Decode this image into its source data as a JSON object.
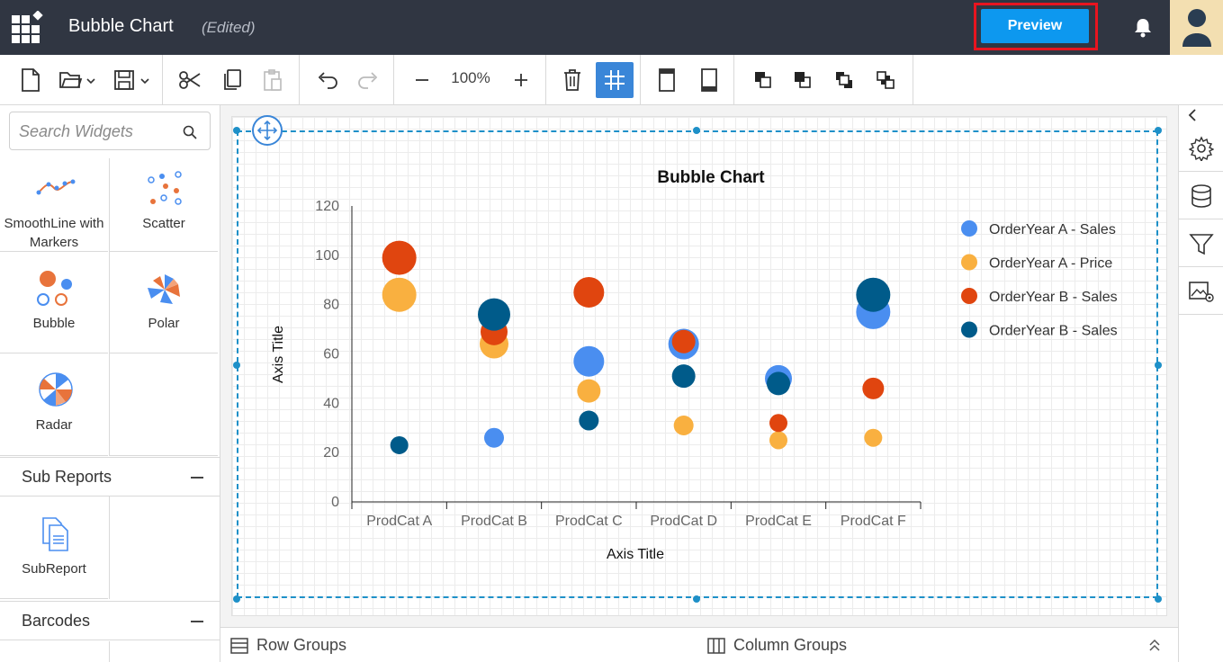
{
  "header": {
    "title": "Bubble Chart",
    "status": "(Edited)",
    "preview_label": "Preview"
  },
  "toolbar": {
    "zoom": "100%"
  },
  "search": {
    "placeholder": "Search Widgets"
  },
  "widgets": [
    {
      "label": "SmoothLine with Markers",
      "icon": "smoothline-icon"
    },
    {
      "label": "Scatter",
      "icon": "scatter-icon"
    },
    {
      "label": "Bubble",
      "icon": "bubble-icon"
    },
    {
      "label": "Polar",
      "icon": "polar-icon"
    },
    {
      "label": "Radar",
      "icon": "radar-icon"
    }
  ],
  "sections": {
    "subreports": "Sub Reports",
    "subreport_widget": "SubReport",
    "barcodes": "Barcodes"
  },
  "bottom_bar": {
    "row_groups": "Row Groups",
    "column_groups": "Column Groups"
  },
  "colors": {
    "header_bg": "#303642",
    "accent": "#0d98ef",
    "highlight": "#e8141f",
    "series": [
      "#4a8ef0",
      "#f9b040",
      "#e0450f",
      "#005b8a"
    ]
  },
  "chart_data": {
    "type": "bubble",
    "title": "Bubble Chart",
    "xlabel": "Axis Title",
    "ylabel": "Axis Title",
    "ylim": [
      0,
      120
    ],
    "yticks": [
      "0",
      "20",
      "40",
      "60",
      "80",
      "100",
      "120"
    ],
    "categories": [
      "ProdCat A",
      "ProdCat B",
      "ProdCat C",
      "ProdCat D",
      "ProdCat E",
      "ProdCat F"
    ],
    "legend_position": "right",
    "series": [
      {
        "name": "OrderYear A - Sales",
        "values": [
          null,
          26,
          57,
          64,
          50,
          77
        ],
        "sizes": [
          null,
          11,
          17,
          17,
          15,
          19
        ]
      },
      {
        "name": "OrderYear A - Price",
        "values": [
          84,
          64,
          45,
          31,
          25,
          26
        ],
        "sizes": [
          19,
          16,
          13,
          11,
          10,
          10
        ]
      },
      {
        "name": "OrderYear B - Sales",
        "values": [
          99,
          69,
          85,
          65,
          32,
          46
        ],
        "sizes": [
          19,
          15,
          17,
          13,
          10,
          12
        ]
      },
      {
        "name": "OrderYear B - Sales",
        "values": [
          23,
          76,
          33,
          null,
          48,
          84
        ],
        "sizes": [
          10,
          18,
          11,
          null,
          13,
          19
        ]
      }
    ],
    "extra_points": [
      {
        "series": 3,
        "category": 3,
        "value": 51,
        "size": 13
      }
    ]
  }
}
